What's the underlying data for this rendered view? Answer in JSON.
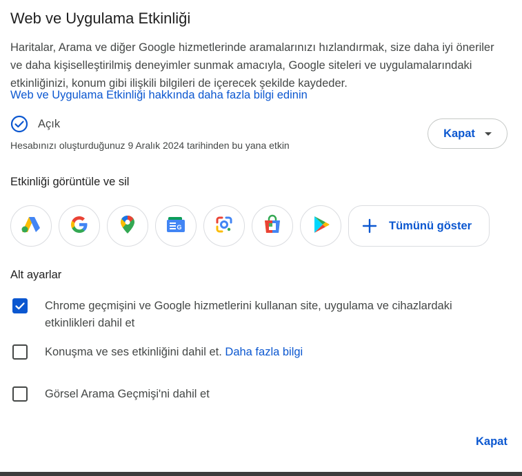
{
  "dialog": {
    "title": "Web ve Uygulama Etkinliği",
    "description": "Haritalar, Arama ve diğer Google hizmetlerinde aramalarınızı hızlandırmak, size daha iyi öneriler ve daha kişiselleştirilmiş deneyimler sunmak amacıyla, Google siteleri ve uygulamalarındaki etkinliğinizi, konum gibi ilişkili bilgileri de içerecek şekilde kaydeder.",
    "learn_more_link": "Web ve Uygulama Etkinliği hakkında daha fazla bilgi edinin",
    "status": "Açık",
    "since_text": "Hesabınızı oluşturduğunuz 9 Aralık 2024 tarihinden bu yana etkin",
    "pause_button_label": "Kapat",
    "close_button_label": "Kapat"
  },
  "activity_section": {
    "title": "Etkinliği görüntüle ve sil",
    "apps": [
      {
        "icon": "google-ads-icon"
      },
      {
        "icon": "google-search-icon"
      },
      {
        "icon": "google-maps-icon"
      },
      {
        "icon": "google-news-icon"
      },
      {
        "icon": "google-lens-icon"
      },
      {
        "icon": "google-shopping-icon"
      },
      {
        "icon": "google-play-icon"
      }
    ],
    "show_all_label": "Tümünü göster"
  },
  "sub_settings": {
    "title": "Alt ayarlar",
    "options": [
      {
        "label": "Chrome geçmişini ve Google hizmetlerini kullanan site, uygulama ve cihazlardaki etkinlikleri dahil et",
        "checked": true
      },
      {
        "label": "Konuşma ve ses etkinliğini dahil et.",
        "link": "Daha fazla bilgi",
        "checked": false
      },
      {
        "label": "Görsel Arama Geçmişi'ni dahil et",
        "checked": false
      }
    ]
  },
  "colors": {
    "accent": "#0b57d0",
    "text": "#1f1f1f",
    "secondary_text": "#444746",
    "border": "#dadce0"
  }
}
